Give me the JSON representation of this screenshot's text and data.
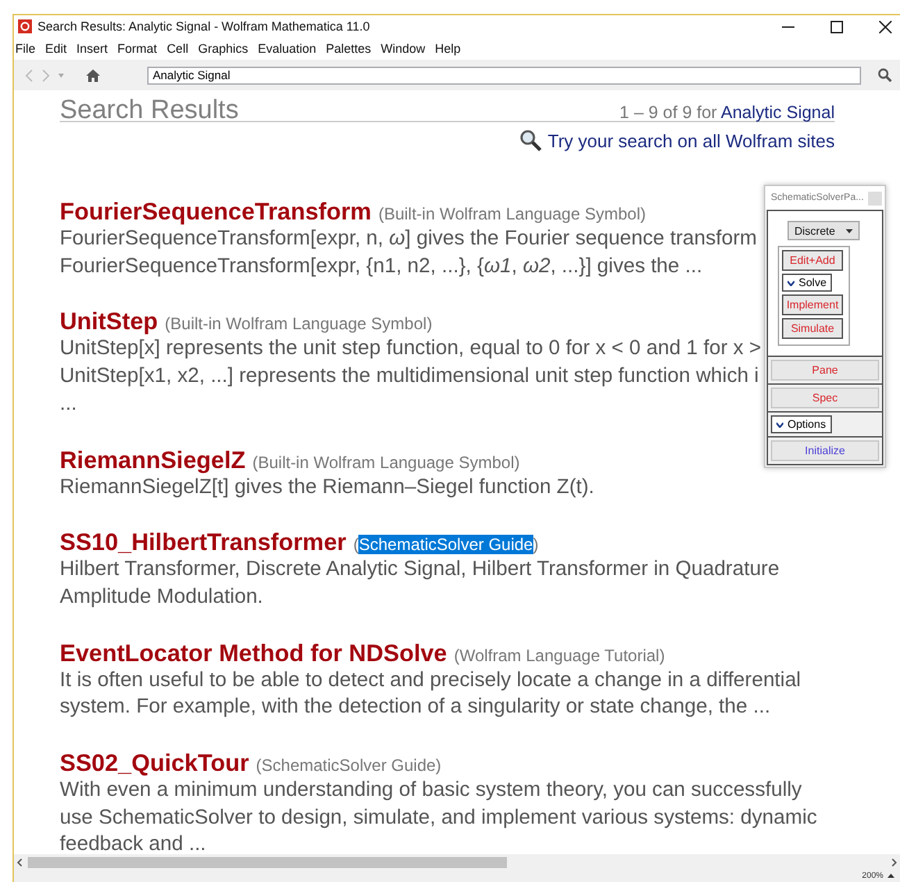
{
  "window": {
    "title": "Search Results: Analytic Signal - Wolfram Mathematica 11.0"
  },
  "menu": [
    "File",
    "Edit",
    "Insert",
    "Format",
    "Cell",
    "Graphics",
    "Evaluation",
    "Palettes",
    "Window",
    "Help"
  ],
  "address_bar": {
    "value": "Analytic Signal"
  },
  "page": {
    "heading": "Search Results",
    "count": "1 – 9 of 9 for",
    "query": "Analytic Signal",
    "all_sites_link": "Try your search on all Wolfram sites"
  },
  "results": [
    {
      "title": "FourierSequenceTransform",
      "source": {
        "open": "(",
        "name": "Built-in Wolfram Language Symbol",
        "close": ")",
        "selected": false
      },
      "lines": [
        "FourierSequenceTransform[expr, n, *ω*] gives the Fourier sequence transform",
        "FourierSequenceTransform[expr, {n1, n2, ...}, {*ω1*, *ω2*, ...}] gives the ..."
      ]
    },
    {
      "title": "UnitStep",
      "source": {
        "open": "(",
        "name": "Built-in Wolfram Language Symbol",
        "close": ")",
        "selected": false
      },
      "lines": [
        "UnitStep[x] represents the unit step function, equal to 0 for x < 0 and 1 for x >",
        "UnitStep[x1, x2, ...] represents the multidimensional unit step function which i",
        "..."
      ]
    },
    {
      "title": "RiemannSiegelZ",
      "source": {
        "open": "(",
        "name": "Built-in Wolfram Language Symbol",
        "close": ")",
        "selected": false
      },
      "lines": [
        "RiemannSiegelZ[t] gives the Riemann–Siegel function Z(t)."
      ]
    },
    {
      "title": "SS10_HilbertTransformer",
      "source": {
        "open": "(",
        "name": "SchematicSolver Guide",
        "close": ")",
        "selected": true
      },
      "lines": [
        "Hilbert Transformer, Discrete Analytic Signal, Hilbert Transformer in Quadrature",
        "Amplitude Modulation."
      ]
    },
    {
      "title": "EventLocator Method for NDSolve",
      "source": {
        "open": "(",
        "name": "Wolfram Language Tutorial",
        "close": ")",
        "selected": false
      },
      "lines": [
        "It is often useful to be able to detect and precisely locate a change in a differential",
        "system. For example, with the detection of a singularity or state change, the ..."
      ]
    },
    {
      "title": "SS02_QuickTour",
      "source": {
        "open": "(",
        "name": "SchematicSolver Guide",
        "close": ")",
        "selected": false
      },
      "lines": [
        "With even a minimum understanding of basic system theory, you can successfully",
        "use SchematicSolver to design, simulate, and implement various systems: dynamic",
        "feedback and ..."
      ]
    }
  ],
  "palette": {
    "title": "SchematicSolverPa...",
    "dropdown": "Discrete",
    "group_items": [
      {
        "kind": "button",
        "label": "Edit+Add",
        "color": "#d9262c"
      },
      {
        "kind": "toggle",
        "label": "Solve",
        "expanded": true
      },
      {
        "kind": "button",
        "label": "Implement",
        "color": "#d9262c"
      },
      {
        "kind": "button",
        "label": "Simulate",
        "color": "#d9262c"
      }
    ],
    "items": [
      {
        "kind": "button",
        "label": "Pane",
        "color": "#d9262c"
      },
      {
        "kind": "button",
        "label": "Spec",
        "color": "#d9262c"
      },
      {
        "kind": "toggle",
        "label": "Options",
        "expanded": true
      },
      {
        "kind": "button",
        "label": "Initialize",
        "color": "#4b3fd6"
      }
    ]
  },
  "status_bar": {
    "zoom": "200%"
  }
}
